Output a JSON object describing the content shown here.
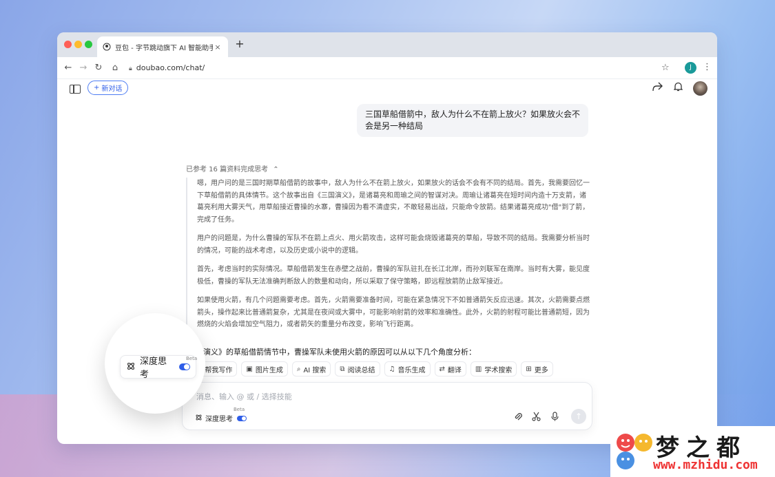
{
  "browser": {
    "tab_title": "豆包 - 字节跳动旗下 AI 智能助手",
    "tab_close": "×",
    "new_tab": "+",
    "url": "doubao.com/chat/",
    "profile_initial": "J"
  },
  "header": {
    "new_chat_label": "新对话"
  },
  "conversation": {
    "user_message": "三国草船借箭中，敌人为什么不在箭上放火？如果放火会不会是另一种结局",
    "reference_summary": "已参考 16 篇资料完成思考",
    "reasoning_paragraphs": [
      "嗯，用户问的是三国时期草船借箭的故事中，敌人为什么不在箭上放火，如果放火的话会不会有不同的结局。首先，我需要回忆一下草船借箭的具体情节。这个故事出自《三国演义》，是诸葛亮和周瑜之间的智谋对决。周瑜让诸葛亮在短时间内造十万支箭，诸葛亮利用大雾天气，用草船接近曹操的水寨，曹操因为看不清虚实，不敢轻易出战，只能命令放箭。结果诸葛亮成功\"借\"到了箭，完成了任务。",
      "用户的问题是，为什么曹操的军队不在箭上点火、用火箭攻击，这样可能会烧毁诸葛亮的草船，导致不同的结局。我需要分析当时的情况，可能的战术考虑，以及历史或小说中的逻辑。",
      "首先，考虑当时的实际情况。草船借箭发生在赤壁之战前，曹操的军队驻扎在长江北岸，而孙刘联军在南岸。当时有大雾，能见度极低，曹操的军队无法准确判断敌人的数量和动向，所以采取了保守策略，即远程放箭防止敌军接近。",
      "如果使用火箭，有几个问题需要考虑。首先，火箭需要准备时间，可能在紧急情况下不如普通箭矢反应迅速。其次，火箭需要点燃箭头，操作起来比普通箭复杂，尤其是在夜间或大雾中，可能影响射箭的效率和准确性。此外，火箭的射程可能比普通箭短，因为燃烧的火焰会增加空气阻力，或者箭矢的重量分布改变，影响飞行距离。"
    ],
    "answer_intro": "三国演义》的草船借箭情节中，曹操军队未使用火箭的原因可以从以下几个角度分析："
  },
  "skills": [
    {
      "icon": "pen-icon",
      "glyph": "✎",
      "label": "帮我写作"
    },
    {
      "icon": "image-icon",
      "glyph": "▣",
      "label": "图片生成"
    },
    {
      "icon": "search-icon",
      "glyph": "⌕",
      "label": "AI 搜索"
    },
    {
      "icon": "read-icon",
      "glyph": "⧉",
      "label": "阅读总结"
    },
    {
      "icon": "music-icon",
      "glyph": "♫",
      "label": "音乐生成"
    },
    {
      "icon": "translate-icon",
      "glyph": "⇄",
      "label": "翻译"
    },
    {
      "icon": "academic-icon",
      "glyph": "▥",
      "label": "学术搜索"
    },
    {
      "icon": "more-icon",
      "glyph": "⊞",
      "label": "更多"
    }
  ],
  "input": {
    "placeholder": "消息、输入 @ 或 / 选择技能",
    "deep_think_label": "深度思考",
    "beta": "Beta"
  },
  "callout": {
    "deep_think_label": "深度思考",
    "beta": "Beta"
  },
  "watermark": {
    "title": "梦之都",
    "url": "www.mzhidu.com"
  },
  "colors": {
    "accent": "#2f5ee8",
    "watermark_red": "#ee3333"
  }
}
